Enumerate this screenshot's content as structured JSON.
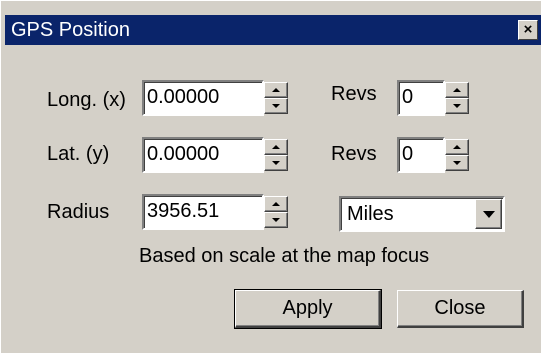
{
  "window": {
    "title": "GPS Position",
    "close_glyph": "×"
  },
  "fields": {
    "longitude": {
      "label": "Long. (x)",
      "value": "0.00000"
    },
    "latitude": {
      "label": "Lat. (y)",
      "value": "0.00000"
    },
    "radius": {
      "label": "Radius",
      "value": "3956.51"
    },
    "revs_long": {
      "label": "Revs",
      "value": "0"
    },
    "revs_lat": {
      "label": "Revs",
      "value": "0"
    }
  },
  "units": {
    "selected": "Miles"
  },
  "note": "Based on scale at the map focus",
  "buttons": {
    "apply": "Apply",
    "close": "Close"
  },
  "colors": {
    "titlebar": "#0a246a",
    "face": "#d4d0c8"
  },
  "icons": [
    "close-icon",
    "spin-up-arrow-icon",
    "spin-down-arrow-icon",
    "dropdown-arrow-icon"
  ]
}
